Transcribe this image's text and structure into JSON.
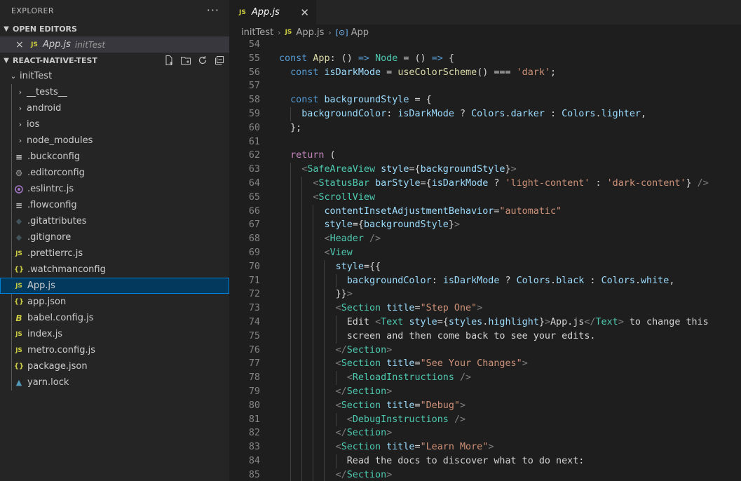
{
  "sidebar": {
    "title": "EXPLORER",
    "more": "···",
    "open_editors": {
      "label": "OPEN EDITORS",
      "items": [
        {
          "name": "App.js",
          "desc": "initTest",
          "icon": "js-file-icon"
        }
      ]
    },
    "project": {
      "label": "REACT-NATIVE-TEST",
      "root": "initTest",
      "items": [
        {
          "name": "__tests__",
          "kind": "folder"
        },
        {
          "name": "android",
          "kind": "folder"
        },
        {
          "name": "ios",
          "kind": "folder"
        },
        {
          "name": "node_modules",
          "kind": "folder"
        },
        {
          "name": ".buckconfig",
          "kind": "file",
          "icon": "lines-file-icon"
        },
        {
          "name": ".editorconfig",
          "kind": "file",
          "icon": "gear-file-icon"
        },
        {
          "name": ".eslintrc.js",
          "kind": "file",
          "icon": "eslint-file-icon"
        },
        {
          "name": ".flowconfig",
          "kind": "file",
          "icon": "lines-file-icon"
        },
        {
          "name": ".gitattributes",
          "kind": "file",
          "icon": "git-file-icon"
        },
        {
          "name": ".gitignore",
          "kind": "file",
          "icon": "git-file-icon"
        },
        {
          "name": ".prettierrc.js",
          "kind": "file",
          "icon": "js-file-icon"
        },
        {
          "name": ".watchmanconfig",
          "kind": "file",
          "icon": "json-file-icon"
        },
        {
          "name": "App.js",
          "kind": "file",
          "icon": "js-file-icon",
          "selected": true
        },
        {
          "name": "app.json",
          "kind": "file",
          "icon": "json-file-icon"
        },
        {
          "name": "babel.config.js",
          "kind": "file",
          "icon": "babel-file-icon"
        },
        {
          "name": "index.js",
          "kind": "file",
          "icon": "js-file-icon"
        },
        {
          "name": "metro.config.js",
          "kind": "file",
          "icon": "js-file-icon"
        },
        {
          "name": "package.json",
          "kind": "file",
          "icon": "json-file-icon"
        },
        {
          "name": "yarn.lock",
          "kind": "file",
          "icon": "yarn-file-icon"
        }
      ]
    }
  },
  "editor": {
    "tab": {
      "name": "App.js",
      "close": "✕",
      "badge": "JS"
    },
    "breadcrumb": [
      "initTest",
      "App.js",
      "App"
    ],
    "lines": [
      {
        "n": "54",
        "t": []
      },
      {
        "n": "55",
        "t": [
          [
            "t-kw",
            "const "
          ],
          [
            "t-fn",
            "App"
          ],
          [
            "t-pu",
            ": () "
          ],
          [
            "t-kw",
            "=>"
          ],
          [
            "t-pu",
            " "
          ],
          [
            "t-ty",
            "Node"
          ],
          [
            "t-pu",
            " = () "
          ],
          [
            "t-kw",
            "=>"
          ],
          [
            "t-pu",
            " {"
          ]
        ]
      },
      {
        "n": "56",
        "t": [
          [
            "t-pu",
            "  "
          ],
          [
            "t-kw",
            "const "
          ],
          [
            "t-va",
            "isDarkMode"
          ],
          [
            "t-pu",
            " = "
          ],
          [
            "t-fn",
            "useColorScheme"
          ],
          [
            "t-pu",
            "() === "
          ],
          [
            "t-st",
            "'dark'"
          ],
          [
            "t-pu",
            ";"
          ]
        ]
      },
      {
        "n": "57",
        "t": []
      },
      {
        "n": "58",
        "t": [
          [
            "t-pu",
            "  "
          ],
          [
            "t-kw",
            "const "
          ],
          [
            "t-va",
            "backgroundStyle"
          ],
          [
            "t-pu",
            " = {"
          ]
        ]
      },
      {
        "n": "59",
        "t": [
          [
            "t-pu",
            "    "
          ],
          [
            "t-va",
            "backgroundColor"
          ],
          [
            "t-pu",
            ": "
          ],
          [
            "t-va",
            "isDarkMode"
          ],
          [
            "t-pu",
            " ? "
          ],
          [
            "t-va",
            "Colors"
          ],
          [
            "t-pu",
            "."
          ],
          [
            "t-va",
            "darker"
          ],
          [
            "t-pu",
            " : "
          ],
          [
            "t-va",
            "Colors"
          ],
          [
            "t-pu",
            "."
          ],
          [
            "t-va",
            "lighter"
          ],
          [
            "t-pu",
            ","
          ]
        ]
      },
      {
        "n": "60",
        "t": [
          [
            "t-pu",
            "  };"
          ]
        ]
      },
      {
        "n": "61",
        "t": []
      },
      {
        "n": "62",
        "t": [
          [
            "t-pu",
            "  "
          ],
          [
            "t-ctl",
            "return"
          ],
          [
            "t-pu",
            " ("
          ]
        ]
      },
      {
        "n": "63",
        "t": [
          [
            "t-pu",
            "    "
          ],
          [
            "t-br",
            "<"
          ],
          [
            "t-ty",
            "SafeAreaView"
          ],
          [
            "t-pu",
            " "
          ],
          [
            "t-va",
            "style"
          ],
          [
            "t-pu",
            "={"
          ],
          [
            "t-va",
            "backgroundStyle"
          ],
          [
            "t-pu",
            "}"
          ],
          [
            "t-br",
            ">"
          ]
        ]
      },
      {
        "n": "64",
        "t": [
          [
            "t-pu",
            "      "
          ],
          [
            "t-br",
            "<"
          ],
          [
            "t-ty",
            "StatusBar"
          ],
          [
            "t-pu",
            " "
          ],
          [
            "t-va",
            "barStyle"
          ],
          [
            "t-pu",
            "={"
          ],
          [
            "t-va",
            "isDarkMode"
          ],
          [
            "t-pu",
            " ? "
          ],
          [
            "t-st",
            "'light-content'"
          ],
          [
            "t-pu",
            " : "
          ],
          [
            "t-st",
            "'dark-content'"
          ],
          [
            "t-pu",
            "} "
          ],
          [
            "t-br",
            "/>"
          ]
        ]
      },
      {
        "n": "65",
        "t": [
          [
            "t-pu",
            "      "
          ],
          [
            "t-br",
            "<"
          ],
          [
            "t-ty",
            "ScrollView"
          ]
        ]
      },
      {
        "n": "66",
        "t": [
          [
            "t-pu",
            "        "
          ],
          [
            "t-va",
            "contentInsetAdjustmentBehavior"
          ],
          [
            "t-pu",
            "="
          ],
          [
            "t-st",
            "\"automatic\""
          ]
        ]
      },
      {
        "n": "67",
        "t": [
          [
            "t-pu",
            "        "
          ],
          [
            "t-va",
            "style"
          ],
          [
            "t-pu",
            "={"
          ],
          [
            "t-va",
            "backgroundStyle"
          ],
          [
            "t-pu",
            "}"
          ],
          [
            "t-br",
            ">"
          ]
        ]
      },
      {
        "n": "68",
        "t": [
          [
            "t-pu",
            "        "
          ],
          [
            "t-br",
            "<"
          ],
          [
            "t-ty",
            "Header"
          ],
          [
            "t-pu",
            " "
          ],
          [
            "t-br",
            "/>"
          ]
        ]
      },
      {
        "n": "69",
        "t": [
          [
            "t-pu",
            "        "
          ],
          [
            "t-br",
            "<"
          ],
          [
            "t-ty",
            "View"
          ]
        ]
      },
      {
        "n": "70",
        "t": [
          [
            "t-pu",
            "          "
          ],
          [
            "t-va",
            "style"
          ],
          [
            "t-pu",
            "={{"
          ]
        ]
      },
      {
        "n": "71",
        "t": [
          [
            "t-pu",
            "            "
          ],
          [
            "t-va",
            "backgroundColor"
          ],
          [
            "t-pu",
            ": "
          ],
          [
            "t-va",
            "isDarkMode"
          ],
          [
            "t-pu",
            " ? "
          ],
          [
            "t-va",
            "Colors"
          ],
          [
            "t-pu",
            "."
          ],
          [
            "t-va",
            "black"
          ],
          [
            "t-pu",
            " : "
          ],
          [
            "t-va",
            "Colors"
          ],
          [
            "t-pu",
            "."
          ],
          [
            "t-va",
            "white"
          ],
          [
            "t-pu",
            ","
          ]
        ]
      },
      {
        "n": "72",
        "t": [
          [
            "t-pu",
            "          }}"
          ],
          [
            "t-br",
            ">"
          ]
        ]
      },
      {
        "n": "73",
        "t": [
          [
            "t-pu",
            "          "
          ],
          [
            "t-br",
            "<"
          ],
          [
            "t-ty",
            "Section"
          ],
          [
            "t-pu",
            " "
          ],
          [
            "t-va",
            "title"
          ],
          [
            "t-pu",
            "="
          ],
          [
            "t-st",
            "\"Step One\""
          ],
          [
            "t-br",
            ">"
          ]
        ]
      },
      {
        "n": "74",
        "t": [
          [
            "t-pu",
            "            Edit "
          ],
          [
            "t-br",
            "<"
          ],
          [
            "t-ty",
            "Text"
          ],
          [
            "t-pu",
            " "
          ],
          [
            "t-va",
            "style"
          ],
          [
            "t-pu",
            "={"
          ],
          [
            "t-va",
            "styles"
          ],
          [
            "t-pu",
            "."
          ],
          [
            "t-va",
            "highlight"
          ],
          [
            "t-pu",
            "}"
          ],
          [
            "t-br",
            ">"
          ],
          [
            "t-pu",
            "App.js"
          ],
          [
            "t-br",
            "</"
          ],
          [
            "t-ty",
            "Text"
          ],
          [
            "t-br",
            ">"
          ],
          [
            "t-pu",
            " to change this"
          ]
        ]
      },
      {
        "n": "75",
        "t": [
          [
            "t-pu",
            "            screen and then come back to see your edits."
          ]
        ]
      },
      {
        "n": "76",
        "t": [
          [
            "t-pu",
            "          "
          ],
          [
            "t-br",
            "</"
          ],
          [
            "t-ty",
            "Section"
          ],
          [
            "t-br",
            ">"
          ]
        ]
      },
      {
        "n": "77",
        "t": [
          [
            "t-pu",
            "          "
          ],
          [
            "t-br",
            "<"
          ],
          [
            "t-ty",
            "Section"
          ],
          [
            "t-pu",
            " "
          ],
          [
            "t-va",
            "title"
          ],
          [
            "t-pu",
            "="
          ],
          [
            "t-st",
            "\"See Your Changes\""
          ],
          [
            "t-br",
            ">"
          ]
        ]
      },
      {
        "n": "78",
        "t": [
          [
            "t-pu",
            "            "
          ],
          [
            "t-br",
            "<"
          ],
          [
            "t-ty",
            "ReloadInstructions"
          ],
          [
            "t-pu",
            " "
          ],
          [
            "t-br",
            "/>"
          ]
        ]
      },
      {
        "n": "79",
        "t": [
          [
            "t-pu",
            "          "
          ],
          [
            "t-br",
            "</"
          ],
          [
            "t-ty",
            "Section"
          ],
          [
            "t-br",
            ">"
          ]
        ]
      },
      {
        "n": "80",
        "t": [
          [
            "t-pu",
            "          "
          ],
          [
            "t-br",
            "<"
          ],
          [
            "t-ty",
            "Section"
          ],
          [
            "t-pu",
            " "
          ],
          [
            "t-va",
            "title"
          ],
          [
            "t-pu",
            "="
          ],
          [
            "t-st",
            "\"Debug\""
          ],
          [
            "t-br",
            ">"
          ]
        ]
      },
      {
        "n": "81",
        "t": [
          [
            "t-pu",
            "            "
          ],
          [
            "t-br",
            "<"
          ],
          [
            "t-ty",
            "DebugInstructions"
          ],
          [
            "t-pu",
            " "
          ],
          [
            "t-br",
            "/>"
          ]
        ]
      },
      {
        "n": "82",
        "t": [
          [
            "t-pu",
            "          "
          ],
          [
            "t-br",
            "</"
          ],
          [
            "t-ty",
            "Section"
          ],
          [
            "t-br",
            ">"
          ]
        ]
      },
      {
        "n": "83",
        "t": [
          [
            "t-pu",
            "          "
          ],
          [
            "t-br",
            "<"
          ],
          [
            "t-ty",
            "Section"
          ],
          [
            "t-pu",
            " "
          ],
          [
            "t-va",
            "title"
          ],
          [
            "t-pu",
            "="
          ],
          [
            "t-st",
            "\"Learn More\""
          ],
          [
            "t-br",
            ">"
          ]
        ]
      },
      {
        "n": "84",
        "t": [
          [
            "t-pu",
            "            Read the docs to discover what to do next:"
          ]
        ]
      },
      {
        "n": "85",
        "t": [
          [
            "t-pu",
            "          "
          ],
          [
            "t-br",
            "</"
          ],
          [
            "t-ty",
            "Section"
          ],
          [
            "t-br",
            ">"
          ]
        ]
      }
    ]
  },
  "colors": {
    "accent": "#007fd4",
    "selection": "#04395e",
    "js": "#cbcb41"
  }
}
